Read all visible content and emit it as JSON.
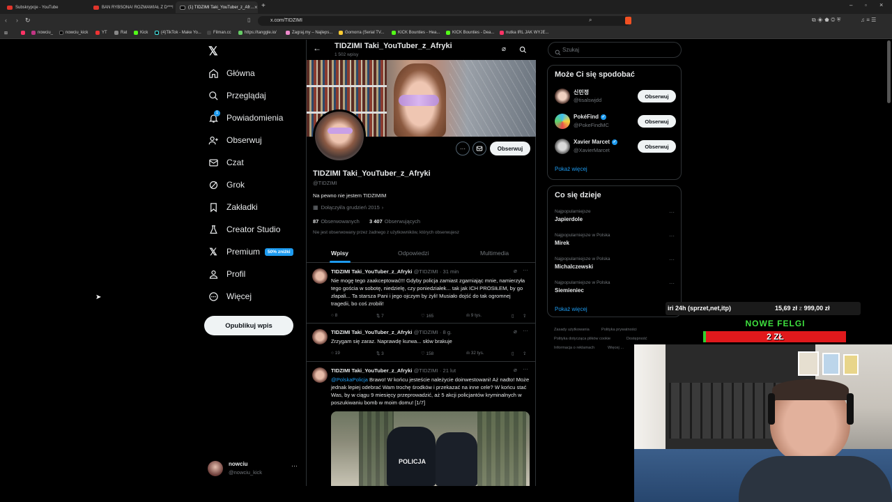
{
  "browser": {
    "tabs": [
      {
        "label": "Subskrypcje - YouTube",
        "active": false
      },
      {
        "label": "BAN RYBSONA! ROZMAWIAŁ Z D***!",
        "active": false
      },
      {
        "label": "(1) TIDZIMI Taki_YouTuber_z_Afr…",
        "active": true
      }
    ],
    "url": "x.com/TIDZIMI",
    "bookmarks": [
      "nowciu_",
      "nowciu_kick",
      "YT",
      "Rat",
      "Kick",
      "(4)TikTok - Make Yo...",
      "Filman.cc",
      "https://tanggle.io/",
      "Zagraj.my – Najleps...",
      "Gomorra (Serial TV...",
      "KICK Bounties - Hea...",
      "KICK Bounties - Dea...",
      "nutka IRL JAK WYJE..."
    ]
  },
  "sidebar": {
    "items": [
      {
        "label": "Główna",
        "icon": "home-icon"
      },
      {
        "label": "Przeglądaj",
        "icon": "search-icon"
      },
      {
        "label": "Powiadomienia",
        "icon": "bell-icon",
        "badge": "1"
      },
      {
        "label": "Obserwuj",
        "icon": "follow-icon"
      },
      {
        "label": "Czat",
        "icon": "mail-icon"
      },
      {
        "label": "Grok",
        "icon": "grok-icon"
      },
      {
        "label": "Zakładki",
        "icon": "bookmark-icon"
      },
      {
        "label": "Creator Studio",
        "icon": "flask-icon"
      },
      {
        "label": "Premium",
        "icon": "x-logo-icon",
        "badge": "50% zniżki"
      },
      {
        "label": "Profil",
        "icon": "person-icon"
      },
      {
        "label": "Więcej",
        "icon": "more-circle-icon"
      }
    ],
    "post_button": "Opublikuj wpis",
    "account": {
      "name": "nowciu",
      "handle": "@nowciu_kick"
    }
  },
  "profile": {
    "header_name": "TIDZIMI Taki_YouTuber_z_Afryki",
    "post_count": "1 502 wpisy",
    "name": "TIDZIMI Taki_YouTuber_z_Afryki",
    "handle": "@TIDZIMI",
    "bio": "Na pewno nie jestem TIDZIMIM",
    "joined": "Dołączył/a grudzień 2015",
    "following_count": "87",
    "following_label": "Obserwowanych",
    "followers_count": "3 407",
    "followers_label": "Obserwujących",
    "not_followed_note": "Nie jest obserwowany przez żadnego z użytkowników, których obserwujesz",
    "follow_button": "Obserwuj",
    "tabs": [
      "Wpisy",
      "Odpowiedzi",
      "Multimedia"
    ],
    "active_tab": "Wpisy"
  },
  "tweets": [
    {
      "name": "TIDZIMI Taki_YouTuber_z_Afryki",
      "handle": "@TIDZIMI",
      "time": "· 31 min",
      "text": "Nie mogę tego zaakceptować!!! Gdyby policja zamiast zgarniając mnie, namierzyła tego gościa w sobotę, niedzielę, czy poniedziałek... tak jak ICH PROSIŁEM, by go złapali... Ta starsza Pani i jego ojczym by żyli! Musiało dojść do tak ogromnej tragedii, bo coś zrobili!",
      "replies": "8",
      "reposts": "7",
      "likes": "165",
      "views": "9 tys."
    },
    {
      "name": "TIDZIMI Taki_YouTuber_z_Afryki",
      "handle": "@TIDZIMI",
      "time": "· 8 g.",
      "text": "Zrzygam się zaraz. Naprawdę kurwa... słów brakuje",
      "replies": "19",
      "reposts": "3",
      "likes": "158",
      "views": "32 tys."
    },
    {
      "name": "TIDZIMI Taki_YouTuber_z_Afryki",
      "handle": "@TIDZIMI",
      "time": "· 21 lut",
      "mention": "@PolskaPolicja",
      "text": " Brawo! W końcu jesteście należycie doinwestowani! Aż nadto! Może jednak lepiej odebrać Wam trochę środków i przekazać na inne cele? W końcu stać Was, by w ciągu 9 miesięcy przeprowadzić, aż 5 akcji policjantów kryminalnych w poszukiwaniu bomb w moim domu! [1/7]",
      "image_label": "POLICJA"
    }
  ],
  "right": {
    "search_placeholder": "Szukaj",
    "suggest_title": "Może Ci się spodobać",
    "suggestions": [
      {
        "name": "신민정",
        "handle": "@tisalswjdd",
        "verified": false,
        "button": "Obserwuj"
      },
      {
        "name": "PokéFind",
        "handle": "@PokeFindMC",
        "verified": true,
        "button": "Obserwuj"
      },
      {
        "name": "Xavier Marcet",
        "handle": "@XavierMarcet",
        "verified": true,
        "button": "Obserwuj"
      }
    ],
    "show_more": "Pokaż więcej",
    "trends_title": "Co się dzieje",
    "trends": [
      {
        "category": "Najpopularniejsze",
        "title": "Japierdole"
      },
      {
        "category": "Najpopularniejsze w Polska",
        "title": "Mirek"
      },
      {
        "category": "Najpopularniejsze w Polska",
        "title": "Michalczewski"
      },
      {
        "category": "Najpopularniejsze w Polska",
        "title": "Siemieniec"
      }
    ],
    "trends_more": "Pokaż więcej",
    "footer": [
      "Zasady użytkowania",
      "Polityka prywatności",
      "Polityka dotycząca plików cookie",
      "Dostępność",
      "Informacja o reklamach",
      "Więcej ..."
    ]
  },
  "overlay": {
    "ticker_left": "iri 24h (sprzet,net,itp)",
    "ticker_amount": "15,69 zł",
    "ticker_sep": "z",
    "ticker_goal": "999,00 zł",
    "goal_title": "NOWE FELGI",
    "goal_value": "2 ZŁ",
    "goal_progress": 0.02,
    "colors": {
      "goal_bar": "#e0191c",
      "goal_fill": "#2fd12f",
      "goal_title": "#3ee03e"
    }
  },
  "colors": {
    "accent": "#1d9bf0",
    "bg": "#000000",
    "border": "#2f3336",
    "muted": "#71767b"
  }
}
